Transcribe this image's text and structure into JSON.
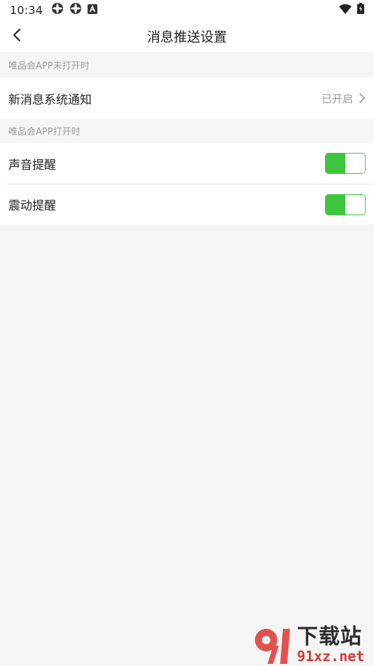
{
  "status_bar": {
    "time": "10:34",
    "left_icons": [
      "app-icon",
      "app-icon",
      "android-notification-icon"
    ],
    "right_icons": [
      "wifi-icon",
      "battery-icon"
    ]
  },
  "header": {
    "title": "消息推送设置",
    "back_icon": "chevron-left-icon"
  },
  "section_closed": {
    "header": "唯品会APP未打开时",
    "item": {
      "label": "新消息系统通知",
      "value": "已开启",
      "icon": "chevron-right-icon"
    }
  },
  "section_open": {
    "header": "唯品会APP打开时",
    "items": [
      {
        "label": "声音提醒",
        "toggle_on": true
      },
      {
        "label": "震动提醒",
        "toggle_on": true
      }
    ]
  },
  "watermark": {
    "title": "下载站",
    "url": "91xz.net"
  },
  "colors": {
    "accent_green": "#3dc53d",
    "background": "#f5f5f5",
    "card": "#ffffff",
    "text_primary": "#222222",
    "text_secondary": "#9a9a9a"
  }
}
